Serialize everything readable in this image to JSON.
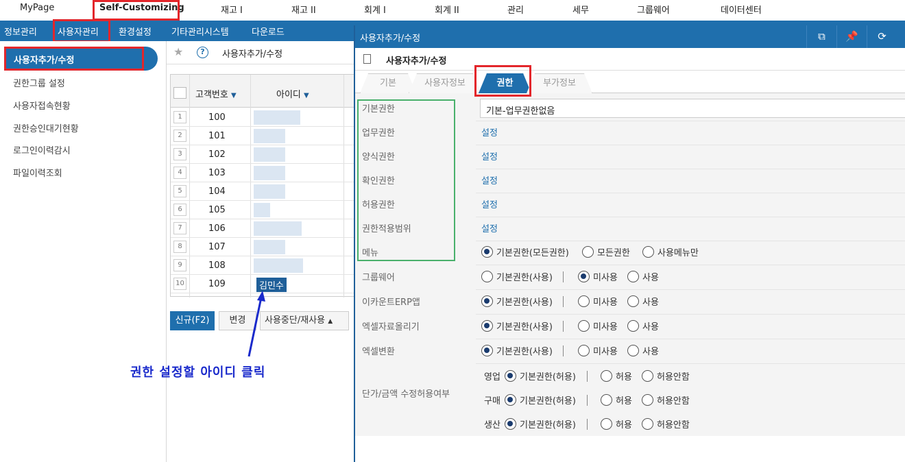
{
  "topnav": {
    "items": [
      "MyPage",
      "Self-Customizing",
      "재고 I",
      "재고 II",
      "회계 I",
      "회계 II",
      "관리",
      "세무",
      "그룹웨어",
      "데이터센터"
    ]
  },
  "subnav": {
    "items": [
      "정보관리",
      "사용자관리",
      "환경설정",
      "기타관리시스템",
      "다운로드"
    ]
  },
  "sidebar": {
    "active": "사용자추가/수정",
    "items": [
      "권한그룹 설정",
      "사용자접속현황",
      "권한승인대기현황",
      "로그인이력감시",
      "파일이력조회"
    ]
  },
  "list": {
    "title": "사용자추가/수정",
    "columns": [
      "고객번호",
      "아이디"
    ],
    "rows": [
      {
        "num": "1",
        "id": "100"
      },
      {
        "num": "2",
        "id": "101"
      },
      {
        "num": "3",
        "id": "102"
      },
      {
        "num": "4",
        "id": "103"
      },
      {
        "num": "5",
        "id": "104"
      },
      {
        "num": "6",
        "id": "105"
      },
      {
        "num": "7",
        "id": "106"
      },
      {
        "num": "8",
        "id": "107"
      },
      {
        "num": "9",
        "id": "108"
      },
      {
        "num": "10",
        "id": "109",
        "user": "김민수"
      }
    ],
    "buttons": {
      "new": "신규(F2)",
      "edit": "변경",
      "suspend": "사용중단/재사용"
    }
  },
  "annotation": "권한 설정할 아이디 클릭",
  "dialog": {
    "title": "사용자추가/수정",
    "subtitle": "사용자추가/수정",
    "tabs": [
      "기본",
      "사용자정보",
      "권한",
      "부가정보"
    ],
    "active_tab": "권한",
    "fields": {
      "basic_label": "기본권한",
      "basic_value": "기본-업무권한없음",
      "task_label": "업무권한",
      "form_label": "양식권한",
      "confirm_label": "확인권한",
      "allow_label": "허용권한",
      "scope_label": "권한적용범위",
      "setting": "설정",
      "menu_label": "메뉴",
      "menu_options": [
        "기본권한(모든권한)",
        "모든권한",
        "사용메뉴만"
      ],
      "groupware_label": "그룹웨어",
      "ecount_label": "이카운트ERP앱",
      "excel_upload_label": "엑셀자료올리기",
      "excel_convert_label": "엑셀변환",
      "use_options": [
        "기본권한(사용)",
        "미사용",
        "사용"
      ],
      "price_label": "단가/금액 수정허용여부",
      "price_sub": [
        "영업",
        "구매",
        "생산"
      ],
      "price_options": [
        "기본권한(허용)",
        "허용",
        "허용안함"
      ]
    }
  }
}
